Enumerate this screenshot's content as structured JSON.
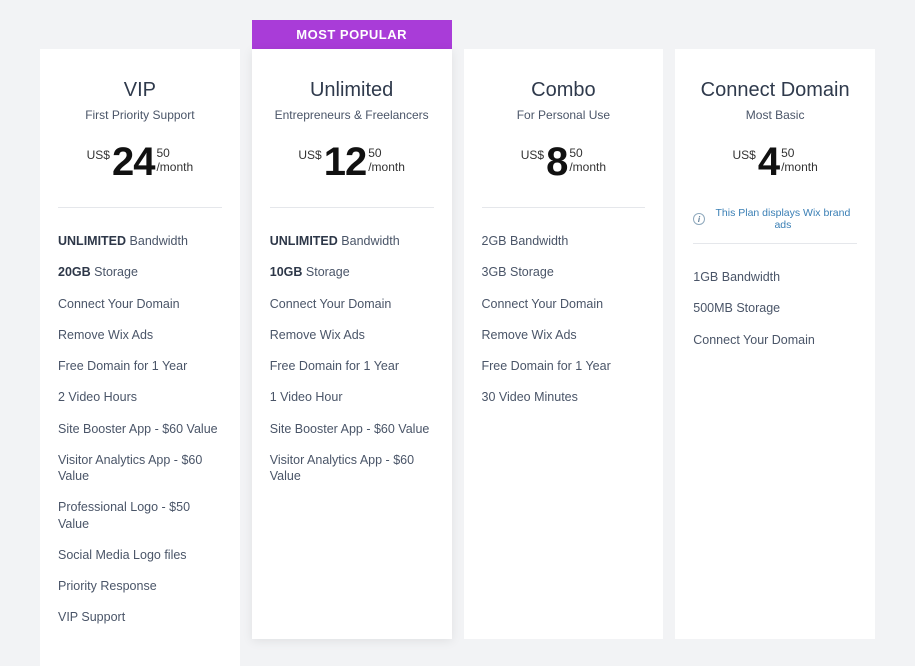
{
  "plans": [
    {
      "badge": "",
      "title": "VIP",
      "subtitle": "First Priority Support",
      "currency": "US$",
      "price_whole": "24",
      "price_cents": "50",
      "period": "/month",
      "note": "",
      "features": [
        {
          "bold": "UNLIMITED",
          "rest": " Bandwidth"
        },
        {
          "bold": "20GB",
          "rest": " Storage"
        },
        {
          "bold": "",
          "rest": "Connect Your Domain"
        },
        {
          "bold": "",
          "rest": "Remove Wix Ads"
        },
        {
          "bold": "",
          "rest": "Free Domain for 1 Year"
        },
        {
          "bold": "",
          "rest": "2 Video Hours"
        },
        {
          "bold": "",
          "rest": "Site Booster App - $60 Value"
        },
        {
          "bold": "",
          "rest": "Visitor Analytics App - $60 Value"
        },
        {
          "bold": "",
          "rest": "Professional Logo - $50 Value"
        },
        {
          "bold": "",
          "rest": "Social Media Logo files"
        },
        {
          "bold": "",
          "rest": "Priority Response"
        },
        {
          "bold": "",
          "rest": "VIP Support"
        }
      ]
    },
    {
      "badge": "MOST POPULAR",
      "title": "Unlimited",
      "subtitle": "Entrepreneurs & Freelancers",
      "currency": "US$",
      "price_whole": "12",
      "price_cents": "50",
      "period": "/month",
      "note": "",
      "features": [
        {
          "bold": "UNLIMITED",
          "rest": " Bandwidth"
        },
        {
          "bold": "10GB",
          "rest": " Storage"
        },
        {
          "bold": "",
          "rest": "Connect Your Domain"
        },
        {
          "bold": "",
          "rest": "Remove Wix Ads"
        },
        {
          "bold": "",
          "rest": "Free Domain for 1 Year"
        },
        {
          "bold": "",
          "rest": "1 Video Hour"
        },
        {
          "bold": "",
          "rest": "Site Booster App - $60 Value"
        },
        {
          "bold": "",
          "rest": "Visitor Analytics App - $60 Value"
        }
      ]
    },
    {
      "badge": "",
      "title": "Combo",
      "subtitle": "For Personal Use",
      "currency": "US$",
      "price_whole": "8",
      "price_cents": "50",
      "period": "/month",
      "note": "",
      "features": [
        {
          "bold": "",
          "rest": "2GB Bandwidth"
        },
        {
          "bold": "",
          "rest": "3GB Storage"
        },
        {
          "bold": "",
          "rest": "Connect Your Domain"
        },
        {
          "bold": "",
          "rest": "Remove Wix Ads"
        },
        {
          "bold": "",
          "rest": "Free Domain for 1 Year"
        },
        {
          "bold": "",
          "rest": "30 Video Minutes"
        }
      ]
    },
    {
      "badge": "",
      "title": "Connect Domain",
      "subtitle": "Most Basic",
      "currency": "US$",
      "price_whole": "4",
      "price_cents": "50",
      "period": "/month",
      "note": "This Plan displays Wix brand ads",
      "features": [
        {
          "bold": "",
          "rest": "1GB Bandwidth"
        },
        {
          "bold": "",
          "rest": "500MB Storage"
        },
        {
          "bold": "",
          "rest": "Connect Your Domain"
        }
      ]
    }
  ]
}
